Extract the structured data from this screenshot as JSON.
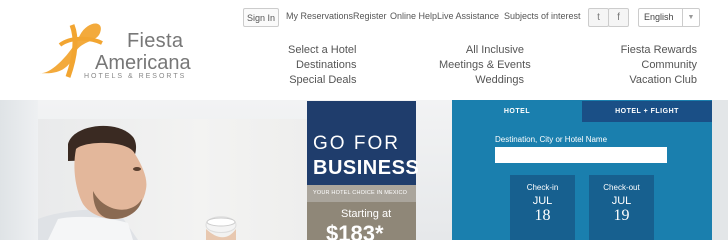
{
  "header": {
    "signin_label": "Sign In",
    "top_links": [
      "My Reservations",
      "Register",
      "Online Help",
      "Live Assistance",
      "Subjects of interest"
    ],
    "social": [
      {
        "icon": "twitter-icon",
        "glyph": "t"
      },
      {
        "icon": "facebook-icon",
        "glyph": "f"
      }
    ],
    "language": "English",
    "logo": {
      "line1": "Fiesta",
      "line2": "Americana",
      "sub": "HOTELS & RESORTS"
    },
    "nav": {
      "col1": [
        "Select a Hotel",
        "Destinations",
        "Special Deals"
      ],
      "col2": [
        "All Inclusive",
        "Meetings & Events",
        "Weddings"
      ],
      "col3": [
        "Fiesta Rewards",
        "Community",
        "Vacation Club"
      ]
    }
  },
  "promo": {
    "line1": "GO FOR",
    "line2": "BUSINESS",
    "tagline": "YOUR HOTEL CHOICE IN MEXICO",
    "starting": "Starting at",
    "price": "$183*"
  },
  "booking": {
    "tabs": [
      "HOTEL",
      "HOTEL + FLIGHT"
    ],
    "destination_label": "Destination, City or Hotel Name",
    "destination_value": "",
    "checkin": {
      "label": "Check-in",
      "month": "JUL",
      "day": "18"
    },
    "checkout": {
      "label": "Check-out",
      "month": "JUL",
      "day": "19"
    }
  },
  "colors": {
    "brand_orange": "#f2a531",
    "booking_blue": "#1a7fae",
    "promo_navy": "#1f3d6c"
  }
}
